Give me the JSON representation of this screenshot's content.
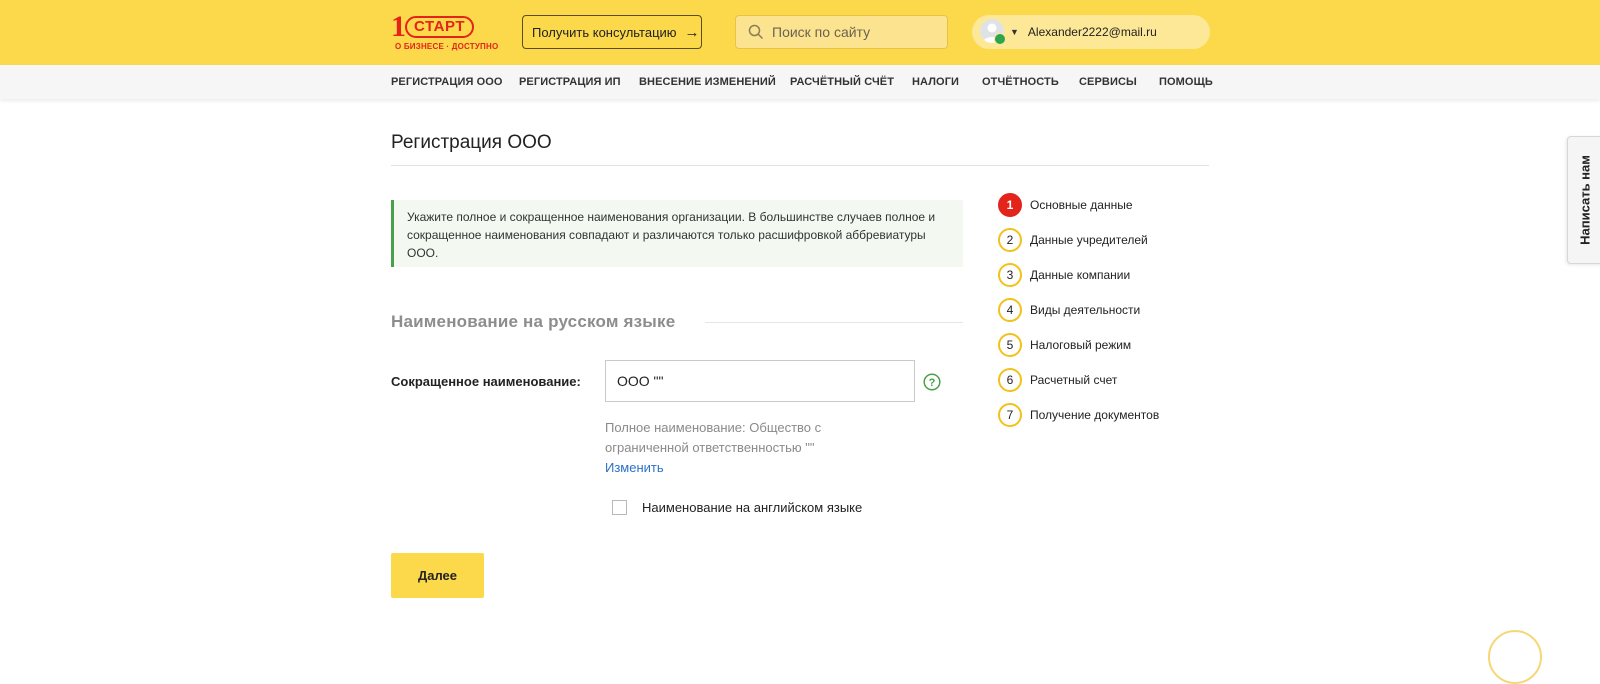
{
  "header": {
    "logo": {
      "mark": "1",
      "pill": "СТАРТ",
      "tagline": "О БИЗНЕСЕ · ДОСТУПНО"
    },
    "consult_button": "Получить консультацию",
    "search": {
      "placeholder": "Поиск по сайту",
      "value": ""
    },
    "user": {
      "email": "Alexander2222@mail.ru"
    }
  },
  "nav": {
    "items": [
      "РЕГИСТРАЦИЯ ООО",
      "РЕГИСТРАЦИЯ ИП",
      "ВНЕСЕНИЕ ИЗМЕНЕНИЙ",
      "РАСЧЁТНЫЙ СЧЁТ",
      "НАЛОГИ",
      "ОТЧЁТНОСТЬ",
      "СЕРВИСЫ",
      "ПОМОЩЬ"
    ]
  },
  "page": {
    "title": "Регистрация ООО",
    "hint_lines": [
      "Укажите полное и сокращенное наименования организации. В большинстве случаев полное и",
      "сокращенное наименования совпадают и различаются только расшифровкой аббревиатуры",
      "ООО."
    ],
    "section_heading": "Наименование на русском языке",
    "short_name_label": "Сокращенное наименование:",
    "short_name_value": "ООО \"\"",
    "full_name_lines": [
      "Полное наименование: Общество с",
      "ограниченной ответственностью \"\""
    ],
    "change_link": "Изменить",
    "english_name_checkbox": {
      "label": "Наименование на английском языке",
      "checked": false
    },
    "next_button": "Далее"
  },
  "steps": {
    "active": 1,
    "items": [
      {
        "num": "1",
        "label": "Основные данные"
      },
      {
        "num": "2",
        "label": "Данные учредителей"
      },
      {
        "num": "3",
        "label": "Данные компании"
      },
      {
        "num": "4",
        "label": "Виды деятельности"
      },
      {
        "num": "5",
        "label": "Налоговый режим"
      },
      {
        "num": "6",
        "label": "Расчетный счет"
      },
      {
        "num": "7",
        "label": "Получение документов"
      }
    ]
  },
  "side_tab": "Написать нам",
  "colors": {
    "header_bg": "#fcd94a",
    "brand_red": "#e3241b",
    "link_blue": "#2a72c9",
    "hint_border_green": "#48a04a",
    "step_ring": "#f2c21b"
  }
}
